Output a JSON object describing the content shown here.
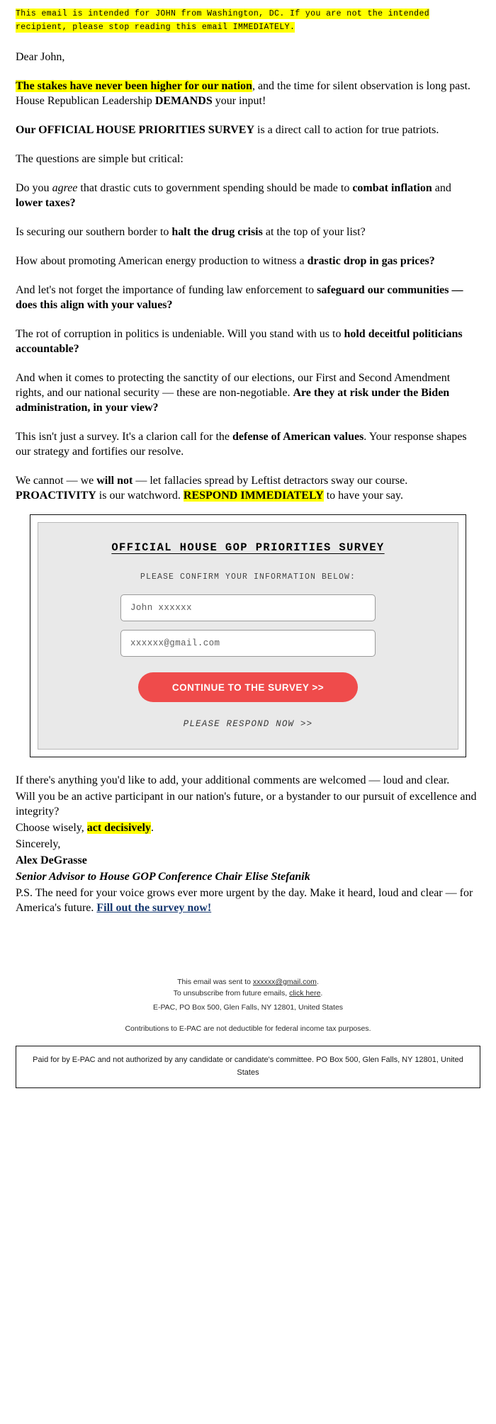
{
  "colors": {
    "highlight": "#ffff00",
    "cta_background": "#ef4b4b",
    "cta_text": "#ffffff",
    "survey_panel": "#e9e9e9",
    "link": "#13366e"
  },
  "top_notice": "This email is intended for JOHN from Washington, DC. If you are not the intended recipient, please stop reading this email IMMEDIATELY.",
  "greeting": "Dear John,",
  "paragraphs": {
    "stakes_highlight": "The stakes have never been higher for our nation",
    "stakes_rest_1": ", and the time for silent observation is long past. House Republican Leadership ",
    "stakes_demands": "DEMANDS",
    "stakes_rest_2": " your input!",
    "survey_lead_1": "Our ",
    "survey_lead_bold": "OFFICIAL HOUSE PRIORITIES SURVEY",
    "survey_lead_2": " is a direct call to action for true patriots.",
    "questions_intro": "The questions are simple but critical:",
    "q1_a": "Do you ",
    "q1_italic": "agree",
    "q1_b": " that drastic cuts to government spending should be made to ",
    "q1_bold1": "combat inflation",
    "q1_c": " and ",
    "q1_bold2": "lower taxes?",
    "q2_a": "Is securing our southern border to ",
    "q2_bold": "halt the drug crisis",
    "q2_b": " at the top of your list?",
    "q3_a": "How about promoting American energy production to witness a ",
    "q3_bold": "drastic drop in gas prices?",
    "q4_a": "And let's not forget the importance of funding law enforcement to ",
    "q4_bold": "safeguard our communities — does this align with your values?",
    "q5_a": "The rot of corruption in politics is undeniable. Will you stand with us to ",
    "q5_bold": "hold deceitful politicians accountable?",
    "q6_a": "And when it comes to protecting the sanctity of our elections, our First and Second Amendment rights, and our national security — these are non-negotiable. ",
    "q6_bold": "Are they at risk under the Biden administration, in your view?",
    "clarion_a": "This isn't just a survey. It's a clarion call for the ",
    "clarion_bold": "defense of American values",
    "clarion_b": ". Your response shapes our strategy and fortifies our resolve.",
    "proactivity_a": "We cannot — we ",
    "proactivity_bold1": "will not",
    "proactivity_b": " — let fallacies spread by Leftist detractors sway our course. ",
    "proactivity_bold2": "PROACTIVITY",
    "proactivity_c": " is our watchword. ",
    "proactivity_highlight": "RESPOND IMMEDIATELY",
    "proactivity_d": " to have your say.",
    "comments": "If there's anything you'd like to add, your additional comments are welcomed — loud and clear.",
    "participant": "Will you be an active participant in our nation's future, or a bystander to our pursuit of excellence and integrity?",
    "choose_a": "Choose wisely, ",
    "choose_highlight": "act decisively",
    "choose_b": "."
  },
  "survey_card": {
    "title": "OFFICIAL HOUSE GOP PRIORITIES SURVEY",
    "subtitle": "PLEASE CONFIRM YOUR INFORMATION BELOW:",
    "name_field_value": "John xxxxxx",
    "name_field_placeholder": "John xxxxxx",
    "email_field_value": "xxxxxx@gmail.com",
    "email_field_placeholder": "xxxxxx@gmail.com",
    "cta_label": "CONTINUE TO THE SURVEY >>",
    "respond_note": "PLEASE RESPOND NOW >>"
  },
  "signature": {
    "closing": "Sincerely,",
    "name": "Alex DeGrasse",
    "title": "Senior Advisor to House GOP Conference Chair Elise Stefanik",
    "ps_text": "P.S. The need for your voice grows ever more urgent by the day. Make it heard, loud and clear — for America's future. ",
    "ps_link": "Fill out the survey now!"
  },
  "footer": {
    "sent_to_prefix": "This email was sent to ",
    "sent_to_email": "xxxxxx@gmail.com",
    "sent_to_suffix": ".",
    "unsubscribe_prefix": "To unsubscribe from future emails, ",
    "unsubscribe_link": "click here",
    "unsubscribe_suffix": ".",
    "address": "E-PAC, PO Box 500, Glen Falls, NY 12801, United States",
    "contributions": "Contributions to E-PAC are not deductible for federal income tax purposes.",
    "paid_for": "Paid for by E-PAC and not authorized by any candidate or candidate's committee. PO Box 500, Glen Falls, NY 12801, United States"
  }
}
